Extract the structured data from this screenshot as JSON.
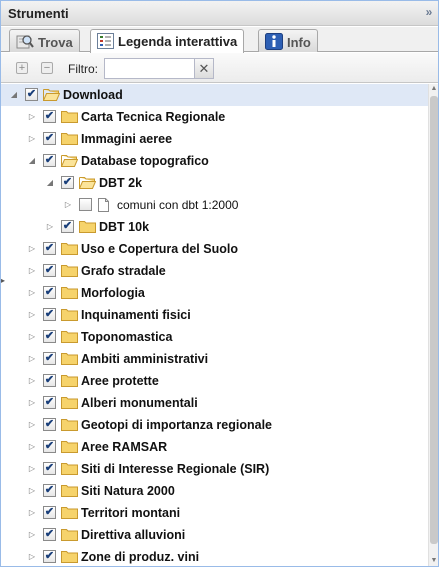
{
  "panel": {
    "title": "Strumenti",
    "collapse_glyph": "»"
  },
  "tabs": [
    {
      "label": "Trova",
      "icon": "magnifier-map-icon",
      "active": false
    },
    {
      "label": "Legenda interattiva",
      "icon": "legend-list-icon",
      "active": true
    },
    {
      "label": "Info",
      "icon": "info-icon",
      "active": false
    }
  ],
  "toolbar": {
    "expand_glyph": "+",
    "collapse_glyph": "−",
    "filter_label": "Filtro:",
    "filter_value": "",
    "clear_glyph": "✕"
  },
  "tree": [
    {
      "label": "Download",
      "level": 0,
      "state": "expanded",
      "checked": true,
      "icon": "folder-open-icon",
      "selected": true
    },
    {
      "label": "Carta Tecnica Regionale",
      "level": 1,
      "state": "collapsed",
      "checked": true,
      "icon": "folder-icon"
    },
    {
      "label": "Immagini aeree",
      "level": 1,
      "state": "collapsed",
      "checked": true,
      "icon": "folder-icon"
    },
    {
      "label": "Database topografico",
      "level": 1,
      "state": "expanded",
      "checked": true,
      "icon": "folder-open-icon"
    },
    {
      "label": "DBT 2k",
      "level": 2,
      "state": "expanded",
      "checked": true,
      "icon": "folder-open-icon"
    },
    {
      "label": "comuni con dbt 1:2000",
      "level": 3,
      "state": "collapsed",
      "checked": false,
      "icon": "document-icon",
      "leaf": true
    },
    {
      "label": "DBT 10k",
      "level": 2,
      "state": "collapsed",
      "checked": true,
      "icon": "folder-icon"
    },
    {
      "label": "Uso e Copertura del Suolo",
      "level": 1,
      "state": "collapsed",
      "checked": true,
      "icon": "folder-icon"
    },
    {
      "label": "Grafo stradale",
      "level": 1,
      "state": "collapsed",
      "checked": true,
      "icon": "folder-icon"
    },
    {
      "label": "Morfologia",
      "level": 1,
      "state": "collapsed",
      "checked": true,
      "icon": "folder-icon"
    },
    {
      "label": "Inquinamenti fisici",
      "level": 1,
      "state": "collapsed",
      "checked": true,
      "icon": "folder-icon"
    },
    {
      "label": "Toponomastica",
      "level": 1,
      "state": "collapsed",
      "checked": true,
      "icon": "folder-icon"
    },
    {
      "label": "Ambiti amministrativi",
      "level": 1,
      "state": "collapsed",
      "checked": true,
      "icon": "folder-icon"
    },
    {
      "label": "Aree protette",
      "level": 1,
      "state": "collapsed",
      "checked": true,
      "icon": "folder-icon"
    },
    {
      "label": "Alberi monumentali",
      "level": 1,
      "state": "collapsed",
      "checked": true,
      "icon": "folder-icon"
    },
    {
      "label": "Geotopi di importanza regionale",
      "level": 1,
      "state": "collapsed",
      "checked": true,
      "icon": "folder-icon"
    },
    {
      "label": "Aree RAMSAR",
      "level": 1,
      "state": "collapsed",
      "checked": true,
      "icon": "folder-icon"
    },
    {
      "label": "Siti di Interesse Regionale (SIR)",
      "level": 1,
      "state": "collapsed",
      "checked": true,
      "icon": "folder-icon"
    },
    {
      "label": "Siti Natura 2000",
      "level": 1,
      "state": "collapsed",
      "checked": true,
      "icon": "folder-icon"
    },
    {
      "label": "Territori montani",
      "level": 1,
      "state": "collapsed",
      "checked": true,
      "icon": "folder-icon"
    },
    {
      "label": "Direttiva alluvioni",
      "level": 1,
      "state": "collapsed",
      "checked": true,
      "icon": "folder-icon"
    },
    {
      "label": "Zone di produz. vini",
      "level": 1,
      "state": "collapsed",
      "checked": true,
      "icon": "folder-icon"
    }
  ],
  "glyphs": {
    "arrow_expanded": "◢",
    "arrow_collapsed": "▷",
    "check_mark": "✔",
    "scroll_up": "▲",
    "scroll_down": "▼",
    "side_handle": "▸"
  },
  "colors": {
    "header_border": "#99bbe8",
    "folder_fill": "#f6d36b",
    "folder_stroke": "#c99a2e",
    "selected_row": "#dfe8f6",
    "info_icon": "#2d5fb4"
  }
}
